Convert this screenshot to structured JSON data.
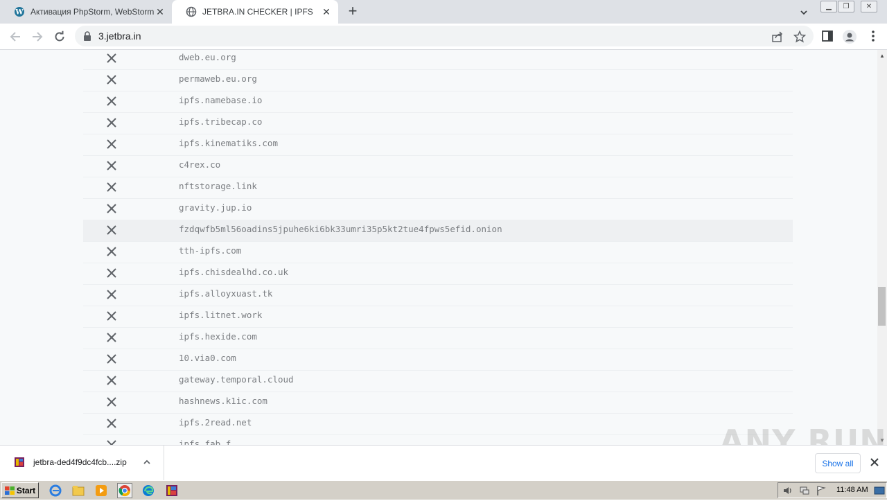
{
  "browser": {
    "tabs": [
      {
        "title": "Активация PhpStorm, WebStorm, IntelliJ",
        "active": false
      },
      {
        "title": "JETBRA.IN CHECKER | IPFS",
        "active": true
      }
    ],
    "url": "3.jetbra.in"
  },
  "hosts": [
    {
      "host": "dweb.eu.org",
      "status": "fail"
    },
    {
      "host": "permaweb.eu.org",
      "status": "fail"
    },
    {
      "host": "ipfs.namebase.io",
      "status": "fail"
    },
    {
      "host": "ipfs.tribecap.co",
      "status": "fail"
    },
    {
      "host": "ipfs.kinematiks.com",
      "status": "fail"
    },
    {
      "host": "c4rex.co",
      "status": "fail"
    },
    {
      "host": "nftstorage.link",
      "status": "fail"
    },
    {
      "host": "gravity.jup.io",
      "status": "fail"
    },
    {
      "host": "fzdqwfb5ml56oadins5jpuhe6ki6bk33umri35p5kt2tue4fpws5efid.onion",
      "status": "fail",
      "highlighted": true
    },
    {
      "host": "tth-ipfs.com",
      "status": "fail"
    },
    {
      "host": "ipfs.chisdealhd.co.uk",
      "status": "fail"
    },
    {
      "host": "ipfs.alloyxuast.tk",
      "status": "fail"
    },
    {
      "host": "ipfs.litnet.work",
      "status": "fail"
    },
    {
      "host": "ipfs.hexide.com",
      "status": "fail"
    },
    {
      "host": "10.via0.com",
      "status": "fail"
    },
    {
      "host": "gateway.temporal.cloud",
      "status": "fail"
    },
    {
      "host": "hashnews.k1ic.com",
      "status": "fail"
    },
    {
      "host": "ipfs.2read.net",
      "status": "fail"
    },
    {
      "host": "ipfs.fab.f",
      "status": "fail"
    }
  ],
  "downloads": {
    "file_name": "jetbra-ded4f9dc4fcb....zip",
    "show_all_label": "Show all"
  },
  "watermark": "ANY RUN",
  "taskbar": {
    "start_label": "Start",
    "clock": "11:48 AM"
  },
  "colors": {
    "fail_mark": "#5f6368",
    "host_text": "#7b7e82",
    "content_bg": "#f7f9fa",
    "link_blue": "#1a73e8"
  }
}
